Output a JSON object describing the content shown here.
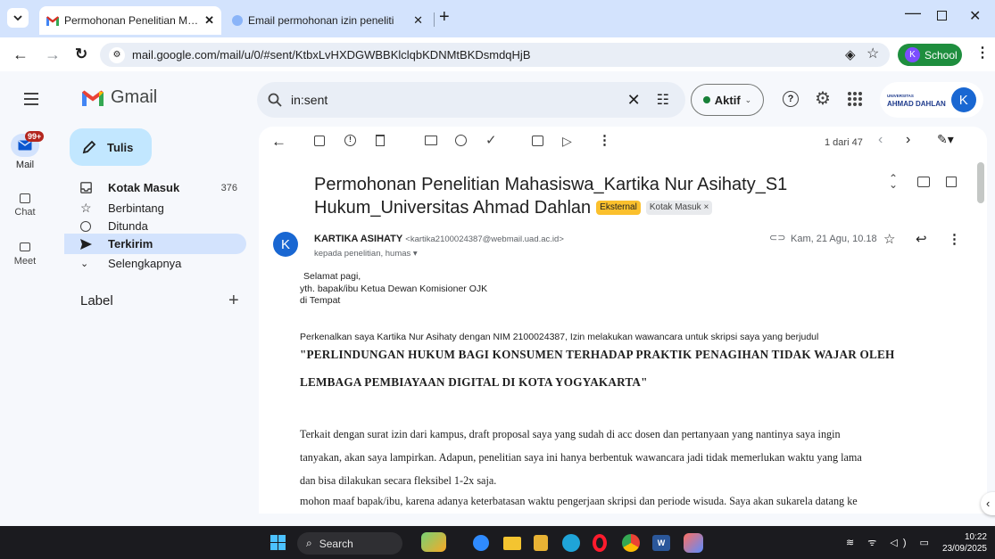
{
  "browser": {
    "tabs": [
      {
        "title": "Permohonan Penelitian Mahasi",
        "active": true
      },
      {
        "title": "Email permohonan izin peneliti",
        "active": false
      }
    ],
    "url": "mail.google.com/mail/u/0/#sent/KtbxLvHXDGWBBKlclqbKDNMtBKDsmdqHjB",
    "profile_label": "School",
    "profile_initial": "K"
  },
  "gmail": {
    "app_name": "Gmail",
    "search_value": "in:sent",
    "status_label": "Aktif",
    "org_logo": {
      "line1": "UNIVERSITAS",
      "line2": "AHMAD DAHLAN"
    },
    "avatar_initial": "K",
    "rail": [
      {
        "label": "Mail",
        "badge": "99+"
      },
      {
        "label": "Chat"
      },
      {
        "label": "Meet"
      }
    ],
    "compose_label": "Tulis",
    "nav": [
      {
        "label": "Kotak Masuk",
        "count": "376",
        "bold": true,
        "icon": "inbox-icon"
      },
      {
        "label": "Berbintang",
        "count": "",
        "bold": false,
        "icon": "star-icon"
      },
      {
        "label": "Ditunda",
        "count": "",
        "bold": false,
        "icon": "clock-icon"
      },
      {
        "label": "Terkirim",
        "count": "",
        "bold": true,
        "icon": "send-icon"
      },
      {
        "label": "Selengkapnya",
        "count": "",
        "bold": false,
        "icon": "chevron-down-icon"
      }
    ],
    "labels_heading": "Label",
    "pagination": "1 dari 47"
  },
  "email": {
    "subject_line1": "Permohonan Penelitian Mahasiswa_Kartika Nur Asihaty_S1",
    "subject_line2": "Hukum_Universitas Ahmad Dahlan",
    "tag_external": "Eksternal",
    "tag_inbox": "Kotak Masuk",
    "sender_initial": "K",
    "sender_name": "KARTIKA ASIHATY",
    "sender_email": "<kartika2100024387@webmail.uad.ac.id>",
    "recipients": "kepada penelitian, humas",
    "date": "Kam, 21 Agu, 10.18",
    "greeting": [
      "Selamat pagi,",
      "yth. bapak/ibu Ketua Dewan Komisioner OJK",
      "di Tempat"
    ],
    "intro": "Perkenalkan saya Kartika Nur Asihaty dengan NIM 2100024387, Izin melakukan wawancara untuk skripsi saya yang berjudul",
    "title_line1": "\"PERLINDUNGAN HUKUM BAGI KONSUMEN TERHADAP PRAKTIK PENAGIHAN TIDAK WAJAR OLEH",
    "title_line2": "LEMBAGA PEMBIAYAAN DIGITAL DI KOTA YOGYAKARTA\"",
    "para1_line1": "Terkait dengan surat izin dari kampus, draft proposal saya yang sudah di acc dosen dan pertanyaan yang nantinya saya ingin",
    "para1_line2": "tanyakan, akan saya lampirkan. Adapun, penelitian saya ini hanya berbentuk wawancara jadi tidak memerlukan waktu yang lama",
    "para1_line3": "dan bisa dilakukan secara fleksibel 1-2x saja.",
    "para2_line1": "mohon maaf bapak/ibu, karena adanya keterbatasan waktu pengerjaan skripsi dan periode wisuda. Saya akan sukarela datang ke"
  },
  "taskbar": {
    "search_label": "Search",
    "time": "10:22",
    "date": "23/09/2025"
  },
  "colors": {
    "accent": "#0b57d0",
    "active_nav": "#d3e3fd",
    "external_tag": "#fbc02d",
    "status_green": "#188038",
    "profile_green": "#1e8e3e"
  }
}
